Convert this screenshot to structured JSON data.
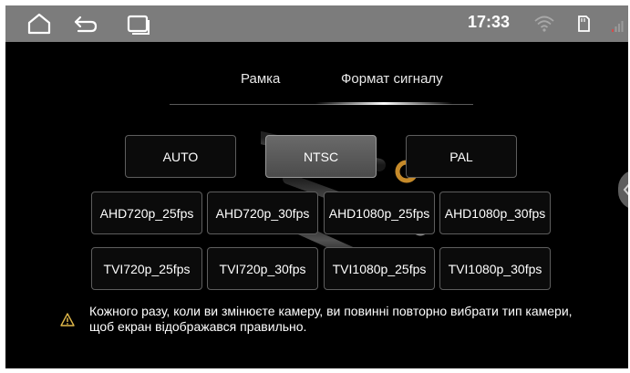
{
  "statusbar": {
    "time": "17:33",
    "icons": [
      "home-icon",
      "back-icon",
      "recent-apps-icon",
      "wifi-icon",
      "sd-card-icon",
      "signal-icon"
    ]
  },
  "tabs": [
    {
      "label": "Рамка",
      "active": false
    },
    {
      "label": "Формат сигналу",
      "active": true
    }
  ],
  "standards": [
    {
      "label": "AUTO",
      "selected": false
    },
    {
      "label": "NTSC",
      "selected": true
    },
    {
      "label": "PAL",
      "selected": false
    }
  ],
  "ahd_formats": [
    "AHD720p_25fps",
    "AHD720p_30fps",
    "AHD1080p_25fps",
    "AHD1080p_30fps"
  ],
  "tvi_formats": [
    "TVI720p_25fps",
    "TVI720p_30fps",
    "TVI1080p_25fps",
    "TVI1080p_30fps"
  ],
  "warning": {
    "icon": "warning-triangle-icon",
    "text": "Кожного разу, коли ви змінюєте камеру, ви повинні повторно вибрати тип камери, щоб екран відображався правильно."
  },
  "colors": {
    "statusbar": "#7c7c7c",
    "background": "#000000",
    "selected_button": "#555555",
    "accent_connector": "#c58a2a"
  }
}
